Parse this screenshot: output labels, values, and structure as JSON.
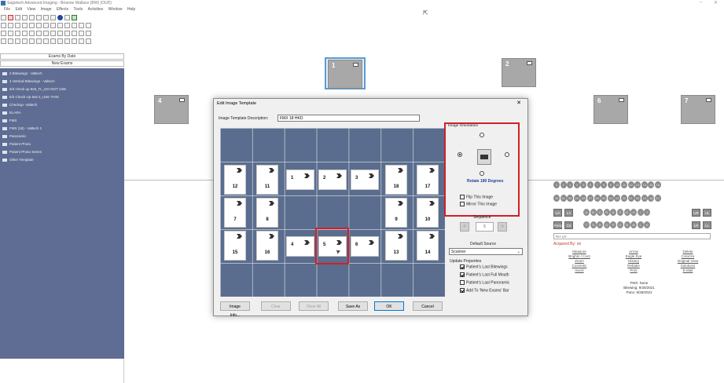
{
  "window": {
    "title": "Sagetech Advanced Imaging - Brianne Wallace (BW) (OUD)",
    "minimize": "–",
    "close": "✕"
  },
  "menu": [
    "File",
    "Edit",
    "View",
    "Image",
    "Effects",
    "Tools",
    "Activities",
    "Window",
    "Help"
  ],
  "left_panel": {
    "header1": "Exams By Date",
    "header2": "New Exams",
    "items": [
      "2 Bitewings - Valtech",
      "4 Vertical Bitewings - Valtech",
      "6/3 check up 9x8_TL_DO NOT USE",
      "6/3 Check Up 9x8 2_USE THIS",
      "Checkup- Valtech",
      "ELARA",
      "FMX",
      "FMX (18) - Valtech 1",
      "Panoramic",
      "Patient Photo",
      "Patient Photo Series",
      "Other Template"
    ]
  },
  "thumbnails": [
    {
      "num": "1",
      "selected": true
    },
    {
      "num": "2",
      "selected": false
    },
    {
      "num": "4",
      "selected": false
    },
    {
      "num": "6",
      "selected": false
    },
    {
      "num": "7",
      "selected": false
    }
  ],
  "dialog": {
    "title": "Edit Image Template",
    "close": "✕",
    "desc_label": "Image Template Description:",
    "desc_value": "FMX 18 HKD",
    "grid_cells": [
      "12",
      "11",
      "1",
      "2",
      "3",
      "18",
      "17",
      "7",
      "8",
      "9",
      "10",
      "15",
      "16",
      "4",
      "5",
      "6",
      "13",
      "14"
    ],
    "orientation": {
      "label": "Image Orientation",
      "rotate_label": "Rotate 180 Degrees",
      "flip": "Flip This Image",
      "mirror": "Mirror This Image"
    },
    "sequence": {
      "label": "Sequence",
      "value": "5",
      "prev": "<",
      "next": ">"
    },
    "default_source": {
      "label": "Default Source",
      "value": "Scanner",
      "arrow": "⌄"
    },
    "update_properties": {
      "label": "Update Properties",
      "items": [
        {
          "label": "Patient's Last Bitewings",
          "checked": true
        },
        {
          "label": "Patient's Last Full Mouth",
          "checked": true
        },
        {
          "label": "Patient's Last Panoramic",
          "checked": false
        },
        {
          "label": "Add To 'New Exams' Bar",
          "checked": true
        }
      ]
    },
    "buttons": {
      "image_info": "Image Info...",
      "clear": "Clear",
      "clear_all": "Clear All",
      "save_as": "Save As",
      "ok": "OK",
      "cancel": "Cancel"
    }
  },
  "right_panel": {
    "teeth_top": [
      "1",
      "2",
      "3",
      "4",
      "5",
      "6",
      "7",
      "8",
      "9",
      "10",
      "11",
      "12",
      "13",
      "14",
      "15",
      "16"
    ],
    "teeth_bottom": [
      "32",
      "31",
      "30",
      "29",
      "28",
      "27",
      "26",
      "25",
      "24",
      "23",
      "22",
      "21",
      "20",
      "19",
      "18",
      "17"
    ],
    "letters_top": [
      "A",
      "B",
      "C",
      "D",
      "E",
      "F",
      "G",
      "H",
      "I",
      "J"
    ],
    "letters_bottom": [
      "T",
      "S",
      "R",
      "Q",
      "P",
      "O",
      "N",
      "M",
      "L",
      "K"
    ],
    "left_buttons": [
      "UA",
      "LA",
      "Perio",
      "Ctr"
    ],
    "right_buttons": [
      "UR",
      "UL",
      "LR",
      "LL"
    ],
    "rh_field": "RH LN",
    "acquired": "Acquired By: on",
    "links_col1": [
      "Measure",
      "Brightn / Cont",
      "Zoom",
      "Cosmetic",
      "Invert"
    ],
    "links_col2": [
      "Arrow",
      "Eagle Eye",
      "History",
      "Rebake",
      "Print"
    ],
    "links_col3": [
      "Delete",
      "Colorize",
      "Original View",
      "Solutions",
      "E-Mail"
    ],
    "fmx_info": [
      "FMX: None",
      "Bitewing: 9/28/2021",
      "Pano: 9/28/2021"
    ]
  }
}
